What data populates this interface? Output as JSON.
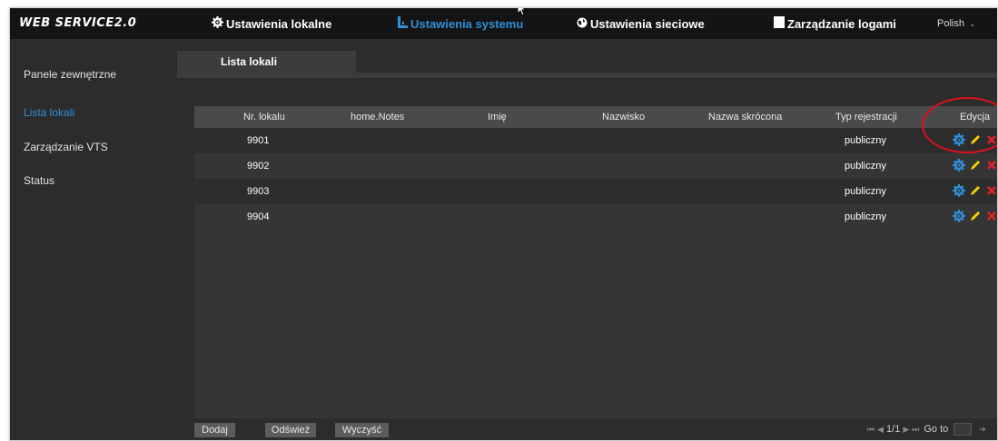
{
  "app": {
    "logo": "WEB SERVICE2.0"
  },
  "top_nav": {
    "local": {
      "icon": "gear-icon",
      "label": "Ustawienia lokalne"
    },
    "system": {
      "icon": "system-icon",
      "label": "Ustawienia systemu"
    },
    "network": {
      "icon": "globe-icon",
      "label": "Ustawienia sieciowe"
    },
    "logs": {
      "icon": "log-icon",
      "label": "Zarządzanie logami"
    },
    "language": {
      "label": "Polish",
      "icon": "chevron-down-icon"
    }
  },
  "sidebar": {
    "items": [
      {
        "label": "Panele zewnętrzne",
        "active": false
      },
      {
        "label": "Lista lokali",
        "active": true
      },
      {
        "label": "Zarządzanie VTS",
        "active": false
      },
      {
        "label": "Status",
        "active": false
      }
    ]
  },
  "tab": {
    "label": "Lista lokali"
  },
  "table": {
    "columns": [
      "Nr. lokalu",
      "home.Notes",
      "Imię",
      "Nazwisko",
      "Nazwa skrócona",
      "Typ rejestracji",
      "Edycja"
    ],
    "rows": [
      {
        "number": "9901",
        "notes": "",
        "first_name": "",
        "last_name": "",
        "short_name": "",
        "reg_type": "publiczny"
      },
      {
        "number": "9902",
        "notes": "",
        "first_name": "",
        "last_name": "",
        "short_name": "",
        "reg_type": "publiczny"
      },
      {
        "number": "9903",
        "notes": "",
        "first_name": "",
        "last_name": "",
        "short_name": "",
        "reg_type": "publiczny"
      },
      {
        "number": "9904",
        "notes": "",
        "first_name": "",
        "last_name": "",
        "short_name": "",
        "reg_type": "publiczny"
      }
    ],
    "action_icons": [
      "settings-icon",
      "edit-icon",
      "delete-icon"
    ]
  },
  "buttons": {
    "add": "Dodaj",
    "refresh": "Odśwież",
    "clear": "Wyczyść"
  },
  "pager": {
    "page": "1/1",
    "goto_label": "Go to"
  },
  "colors": {
    "accent": "#2f8fd8",
    "annotation": "#e0101a",
    "edit": "#f2d200",
    "delete": "#e8202a"
  }
}
